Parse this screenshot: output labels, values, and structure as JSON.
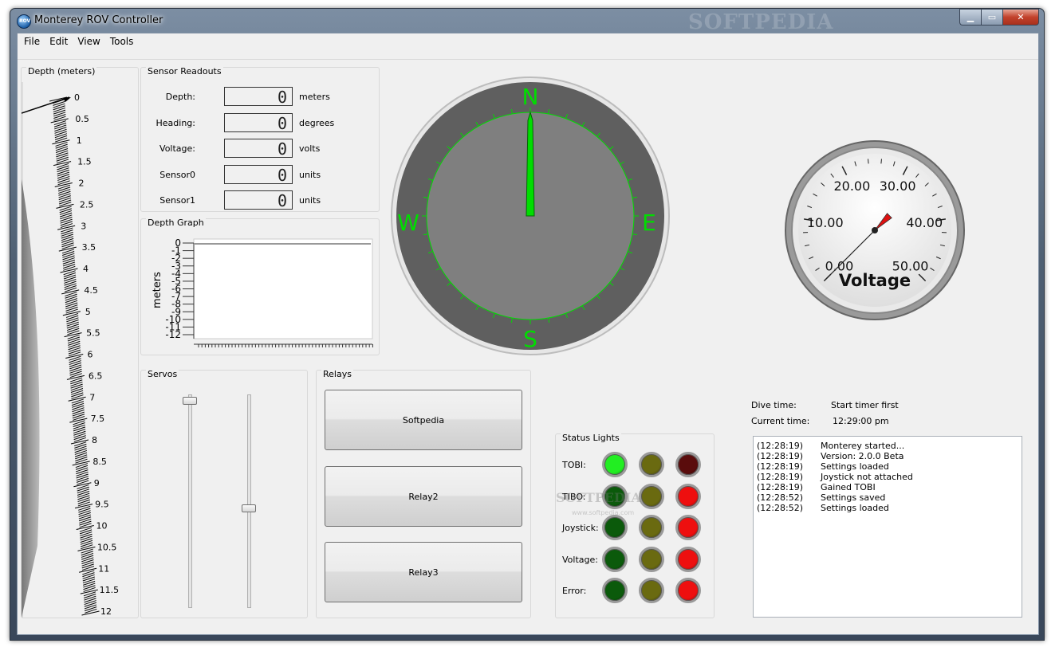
{
  "window": {
    "title": "Monterey ROV Controller",
    "watermark": "SOFTPEDIA",
    "app_icon_text": "ROV"
  },
  "menu": [
    "File",
    "Edit",
    "View",
    "Tools"
  ],
  "depth_gauge": {
    "title": "Depth (meters)",
    "ticks": [
      "0",
      "0.5",
      "1",
      "1.5",
      "2",
      "2.5",
      "3",
      "3.5",
      "4",
      "4.5",
      "5",
      "5.5",
      "6",
      "6.5",
      "7",
      "7.5",
      "8",
      "8.5",
      "9",
      "9.5",
      "10",
      "10.5",
      "11",
      "11.5",
      "12"
    ],
    "value": 0
  },
  "sensor_readouts": {
    "title": "Sensor Readouts",
    "rows": [
      {
        "label": "Depth:",
        "value": "0",
        "unit": "meters"
      },
      {
        "label": "Heading:",
        "value": "0",
        "unit": "degrees"
      },
      {
        "label": "Voltage:",
        "value": "0",
        "unit": "volts"
      },
      {
        "label": "Sensor0",
        "value": "0",
        "unit": "units"
      },
      {
        "label": "Sensor1",
        "value": "0",
        "unit": "units"
      }
    ]
  },
  "depth_graph": {
    "title": "Depth Graph",
    "ylabel": "meters",
    "yticks": [
      "0",
      "-1",
      "-2",
      "-3",
      "-4",
      "-5",
      "-6",
      "-7",
      "-8",
      "-9",
      "-10",
      "-11",
      "-12"
    ]
  },
  "compass": {
    "north": "N",
    "south": "S",
    "east": "E",
    "west": "W",
    "heading": 0
  },
  "voltage_gauge": {
    "title": "Voltage",
    "labels": [
      "0.00",
      "10.00",
      "20.00",
      "30.00",
      "40.00",
      "50.00"
    ],
    "value": 0
  },
  "servos": {
    "title": "Servos",
    "servo1_level": 0.0,
    "servo2_level": 0.5
  },
  "relays": {
    "title": "Relays",
    "buttons": [
      "Softpedia",
      "Relay2",
      "Relay3"
    ]
  },
  "status_lights": {
    "title": "Status Lights",
    "rows": [
      {
        "label": "TOBI:",
        "states": [
          "on",
          "off",
          "off"
        ]
      },
      {
        "label": "TIBO:",
        "states": [
          "off",
          "off",
          "on"
        ]
      },
      {
        "label": "Joystick:",
        "states": [
          "off",
          "off",
          "on"
        ]
      },
      {
        "label": "Voltage:",
        "states": [
          "off",
          "off",
          "on"
        ]
      },
      {
        "label": "Error:",
        "states": [
          "off",
          "off",
          "on"
        ]
      }
    ],
    "colors": {
      "green_on": "#22ee22",
      "green_off": "#0b5a0b",
      "yellow_off": "#6a6a10",
      "red_on": "#ee0f0f",
      "red_off": "#5a0c0c"
    },
    "watermark": "SOFTPEDIA",
    "watermark_sub": "www.softpedia.com"
  },
  "dive_info": {
    "dive_time_label": "Dive time:",
    "dive_time_value": "Start timer first",
    "current_time_label": "Current time:",
    "current_time_value": "12:29:00 pm"
  },
  "log": [
    {
      "time": "(12:28:19)",
      "message": "Monterey started..."
    },
    {
      "time": "(12:28:19)",
      "message": "Version: 2.0.0 Beta"
    },
    {
      "time": "(12:28:19)",
      "message": "Settings loaded"
    },
    {
      "time": "(12:28:19)",
      "message": "Joystick not attached"
    },
    {
      "time": "(12:28:19)",
      "message": "Gained TOBI"
    },
    {
      "time": "(12:28:52)",
      "message": "Settings saved"
    },
    {
      "time": "(12:28:52)",
      "message": "Settings loaded"
    }
  ],
  "theme": {
    "compass_green": "#00dd00",
    "compass_bezel": "#5f5f5f",
    "compass_face": "#7f7f7f",
    "needle_red": "#dd1111"
  }
}
